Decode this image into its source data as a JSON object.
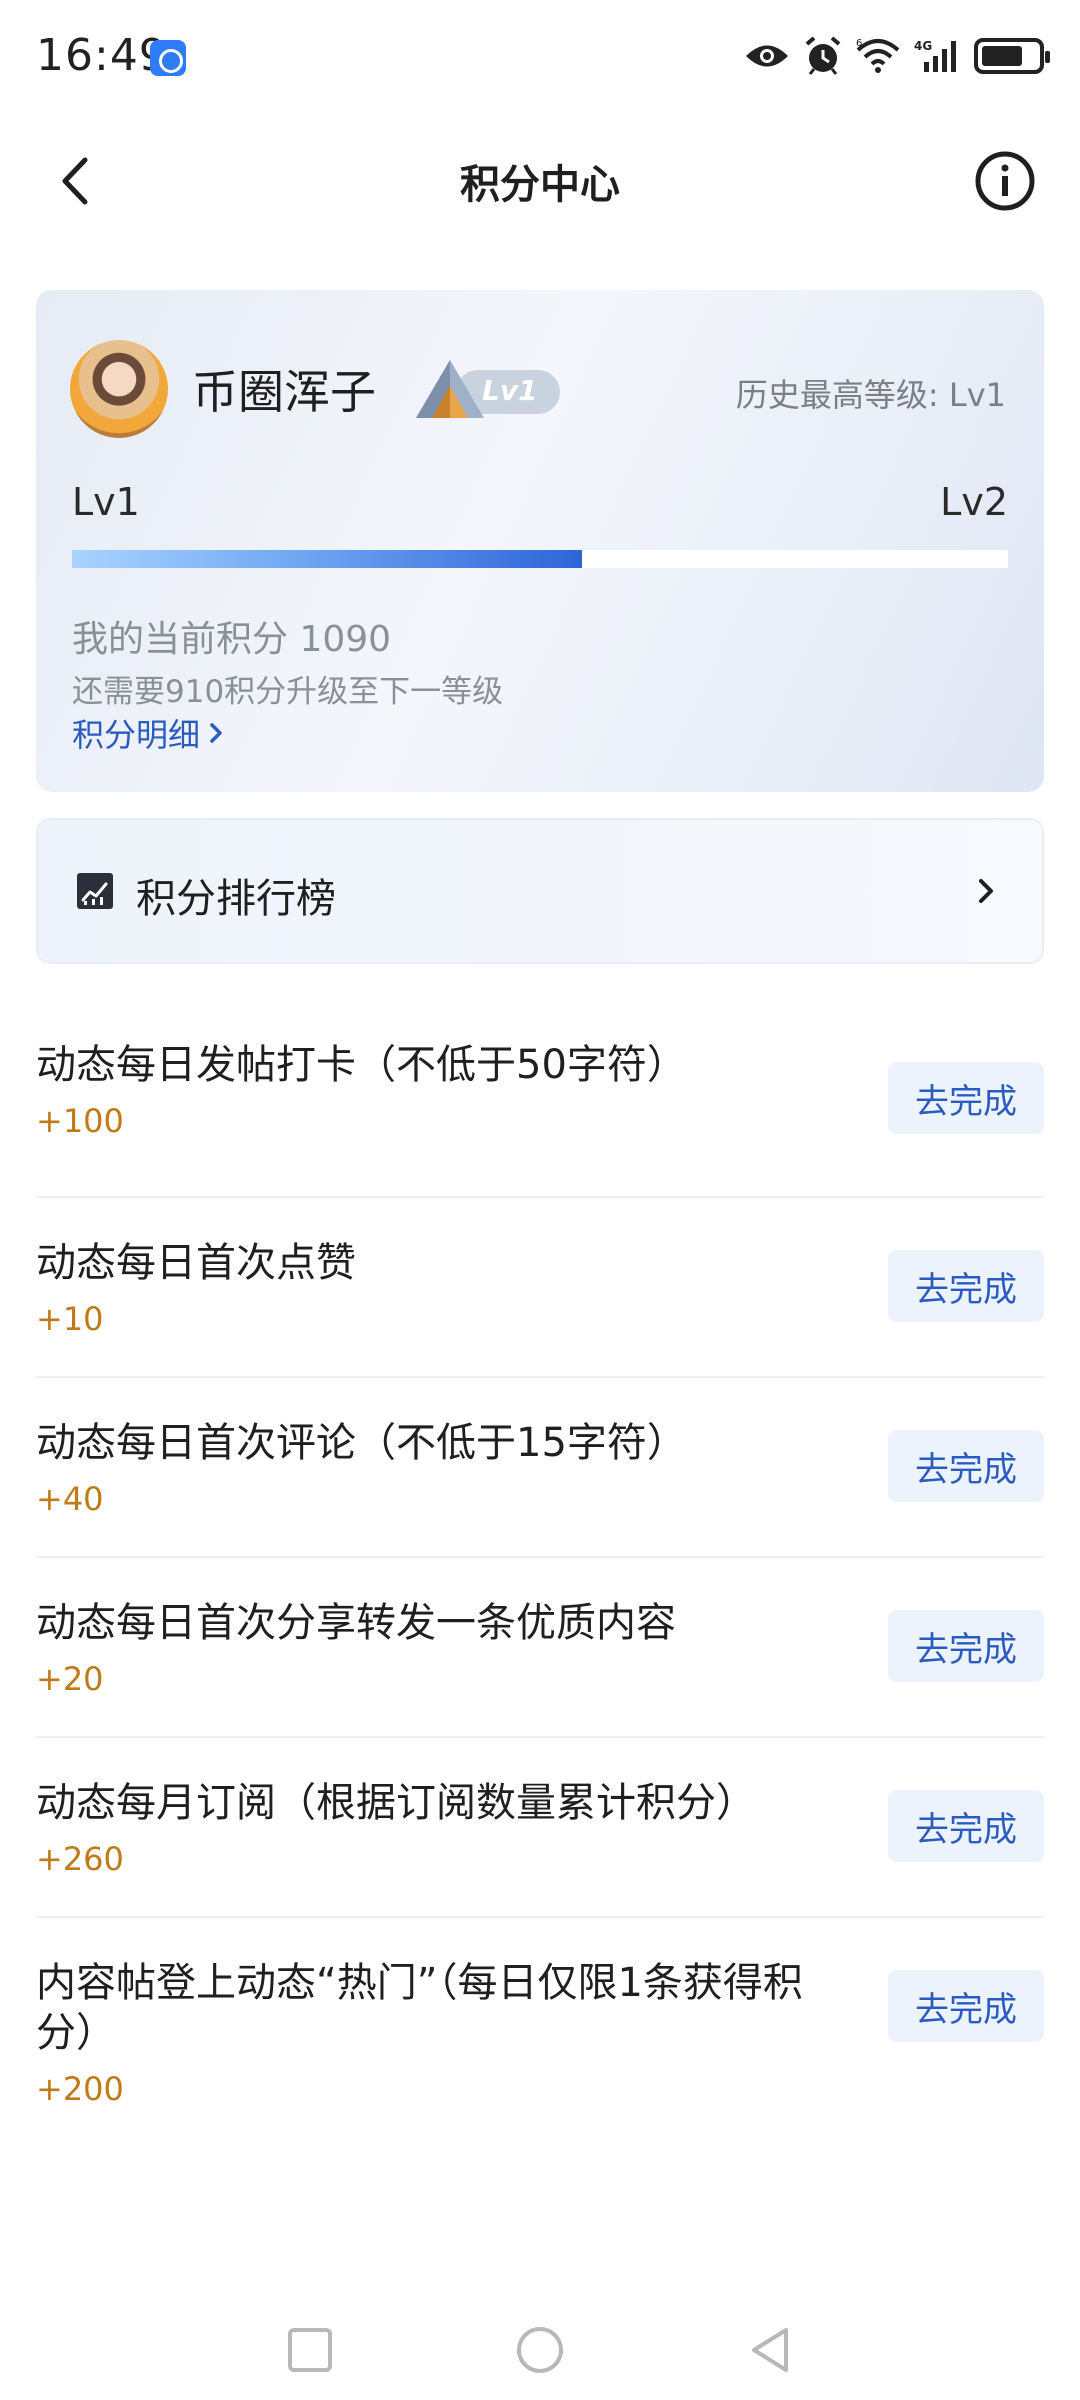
{
  "status_bar": {
    "time": "16:49",
    "icons": [
      "app-notification-icon",
      "eye-icon",
      "alarm-icon",
      "wifi-icon",
      "signal-4g-icon",
      "battery-icon"
    ]
  },
  "nav": {
    "title": "积分中心",
    "back_icon": "chevron-left-icon",
    "info_icon": "info-icon"
  },
  "level_card": {
    "username": "币圈浑子",
    "badge_label": "Lv1",
    "history_level": "历史最高等级: Lv1",
    "level_start": "Lv1",
    "level_end": "Lv2",
    "progress_fraction": 0.545,
    "current_points_text": "我的当前积分 1090",
    "need_points_text": "还需要910积分升级至下一等级",
    "detail_link": "积分明细"
  },
  "ranking": {
    "label": "积分排行榜",
    "icon": "chart-icon"
  },
  "tasks": [
    {
      "title": "动态每日发帖打卡（不低于50字符）",
      "points": "+100",
      "button": "去完成"
    },
    {
      "title": "动态每日首次点赞",
      "points": "+10",
      "button": "去完成"
    },
    {
      "title": "动态每日首次评论（不低于15字符）",
      "points": "+40",
      "button": "去完成"
    },
    {
      "title": "动态每日首次分享转发一条优质内容",
      "points": "+20",
      "button": "去完成"
    },
    {
      "title": "动态每月订阅（根据订阅数量累计积分）",
      "points": "+260",
      "button": "去完成"
    },
    {
      "title": "内容帖登上动态“热门”（每日仅限1条获得积分）",
      "points": "+200",
      "button": "去完成"
    }
  ],
  "colors": {
    "accent_blue": "#2a5cc0",
    "points_orange": "#c07a16",
    "button_bg": "#edf3fc"
  }
}
